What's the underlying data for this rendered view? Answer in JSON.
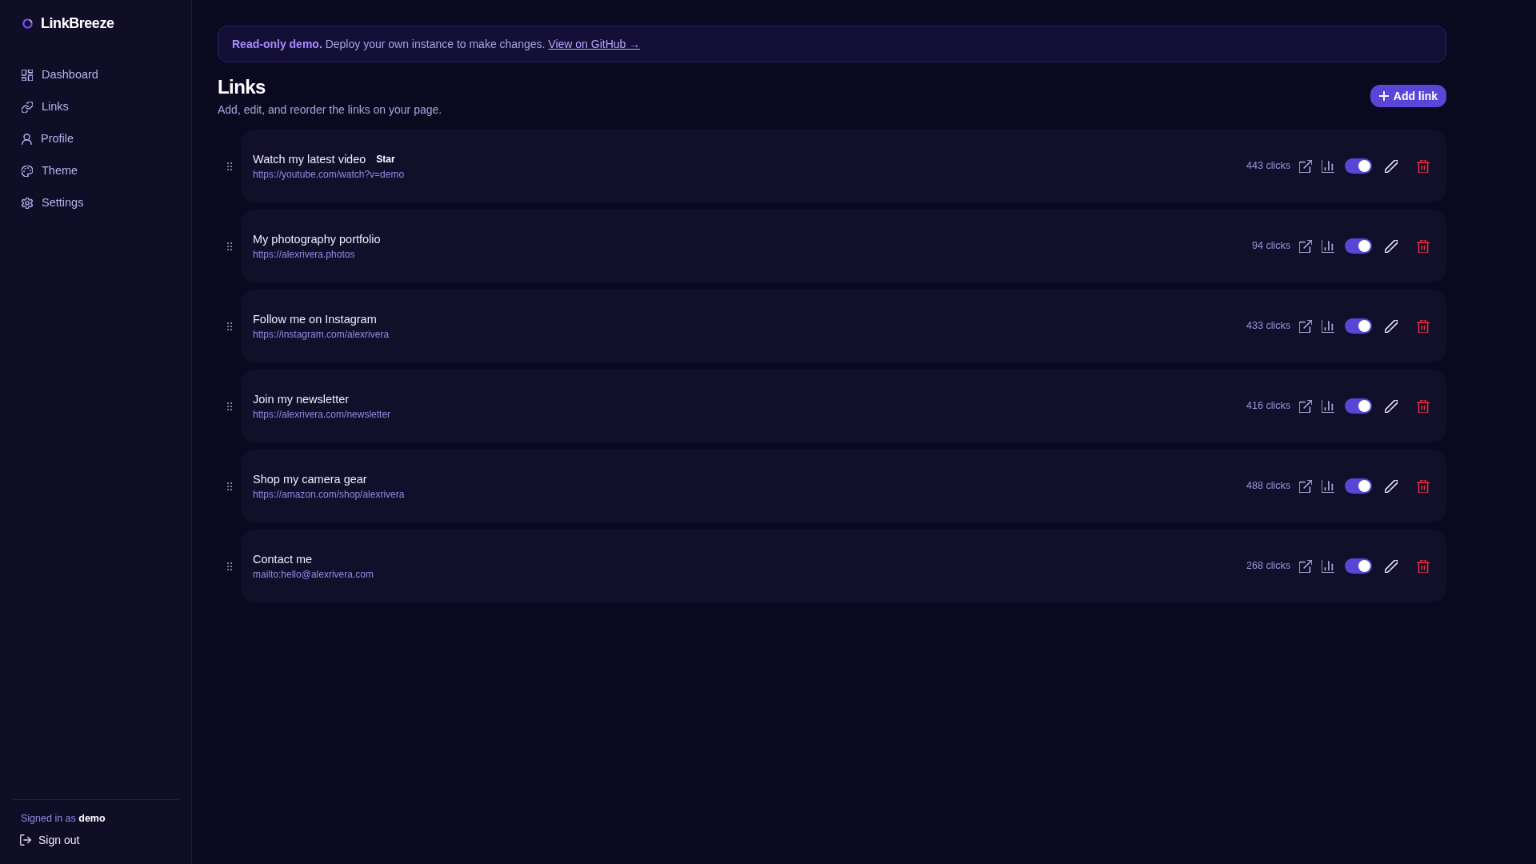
{
  "app": {
    "name": "LinkBreeze"
  },
  "sidebar": {
    "items": [
      "Dashboard",
      "Links",
      "Profile",
      "Theme",
      "Settings"
    ],
    "signed_in": "Signed in as **demo**",
    "sign_out": "Sign out"
  },
  "banner": {
    "text": "**Read-only demo.** Deploy your own instance to make changes.",
    "link": "View on GitHub →"
  },
  "header": {
    "title": "Links",
    "subtitle": "Add, edit, and reorder the links on your page.",
    "add_button": "Add link"
  },
  "links": [
    {
      "title": "Watch my latest video",
      "tag": "Star",
      "url": "https://youtube.com/watch?v=demo",
      "clicks": "443 clicks",
      "enabled": true
    },
    {
      "title": "My photography portfolio",
      "url": "https://alexrivera.photos",
      "clicks": "94 clicks",
      "enabled": true
    },
    {
      "title": "Follow me on Instagram",
      "url": "https://instagram.com/alexrivera",
      "clicks": "433 clicks",
      "enabled": true
    },
    {
      "title": "Join my newsletter",
      "url": "https://alexrivera.com/newsletter",
      "clicks": "416 clicks",
      "enabled": true
    },
    {
      "title": "Shop my camera gear",
      "url": "https://amazon.com/shop/alexrivera",
      "clicks": "488 clicks",
      "enabled": true
    },
    {
      "title": "Contact me",
      "url": "mailto:hello@alexrivera.com",
      "clicks": "268 clicks",
      "enabled": true
    }
  ]
}
